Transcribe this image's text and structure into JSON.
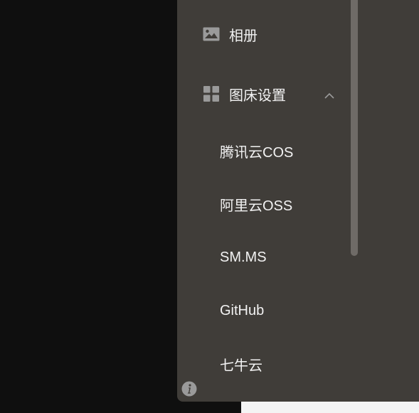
{
  "sidebar": {
    "items": [
      {
        "label": "相册",
        "icon": "image-icon"
      }
    ],
    "group": {
      "label": "图床设置",
      "icon": "grid-icon",
      "expanded": true,
      "children": [
        {
          "label": "腾讯云COS"
        },
        {
          "label": "阿里云OSS"
        },
        {
          "label": "SM.MS"
        },
        {
          "label": "GitHub"
        },
        {
          "label": "七牛云"
        }
      ]
    }
  },
  "colors": {
    "panel_bg": "#403d39",
    "backdrop": "#0f0f0f",
    "text": "#f2f2f2",
    "icon": "#9a9a9a",
    "scrollbar": "#6f6b67"
  }
}
